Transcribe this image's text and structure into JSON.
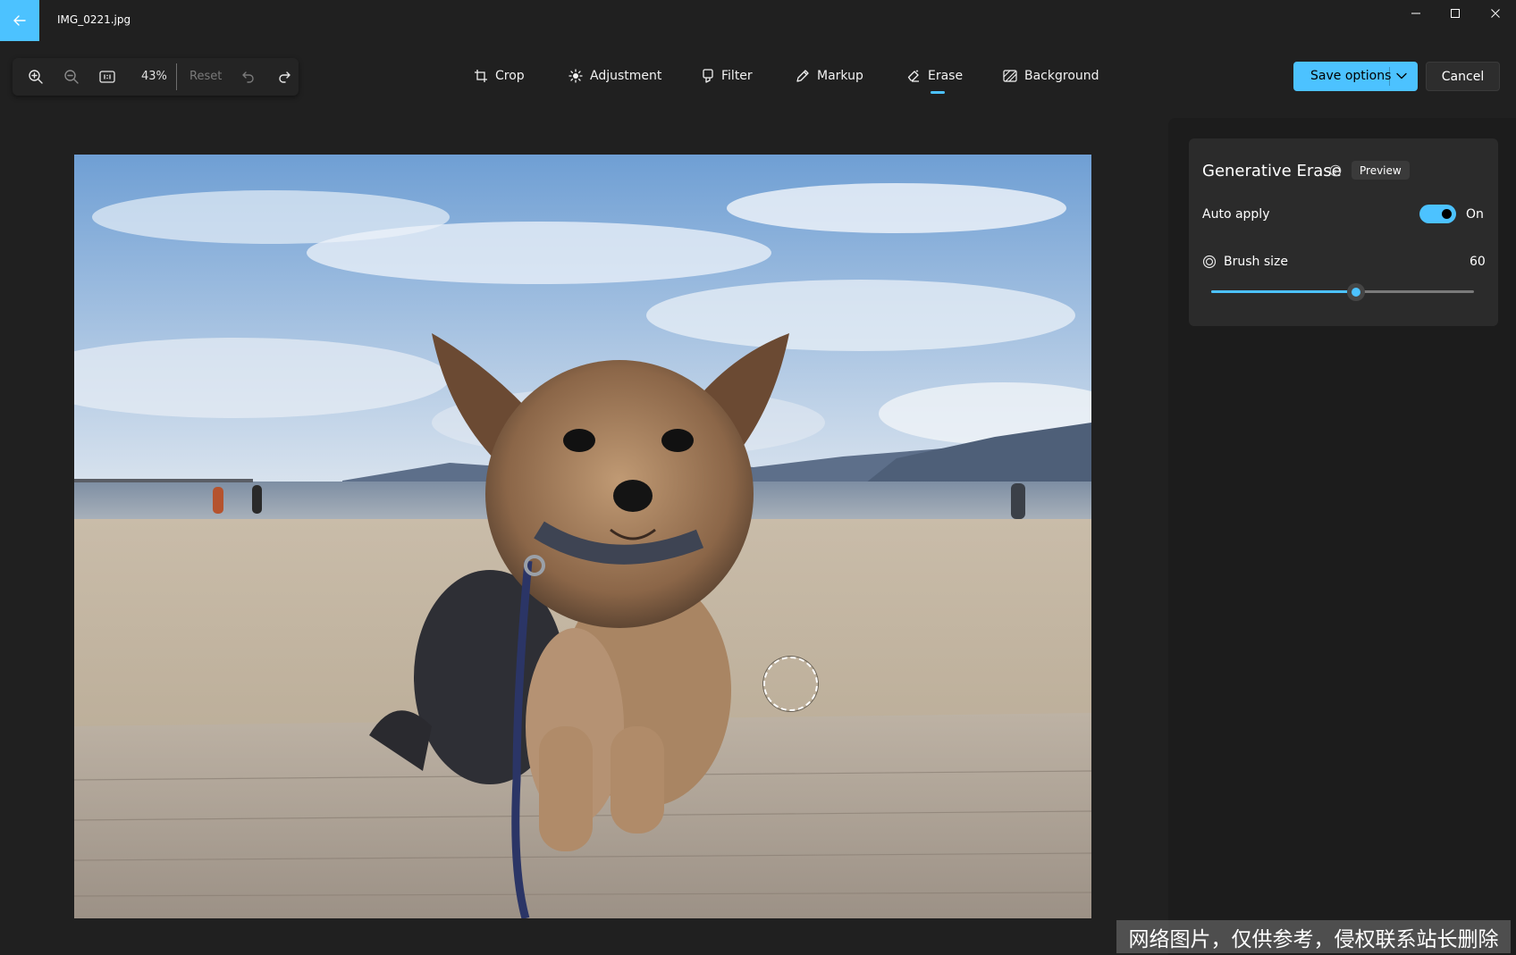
{
  "window": {
    "file_name": "IMG_0221.jpg"
  },
  "toolbar": {
    "zoom_percent": "43%",
    "reset_label": "Reset",
    "tools": [
      {
        "id": "crop",
        "label": "Crop",
        "icon": "crop-icon"
      },
      {
        "id": "adjustment",
        "label": "Adjustment",
        "icon": "brightness-icon"
      },
      {
        "id": "filter",
        "label": "Filter",
        "icon": "filter-icon"
      },
      {
        "id": "markup",
        "label": "Markup",
        "icon": "pen-icon"
      },
      {
        "id": "erase",
        "label": "Erase",
        "icon": "eraser-icon",
        "selected": true
      },
      {
        "id": "background",
        "label": "Background",
        "icon": "background-icon"
      }
    ],
    "save_label": "Save options",
    "cancel_label": "Cancel"
  },
  "erase_panel": {
    "title": "Generative Erase",
    "badge": "Preview",
    "auto_apply": {
      "label": "Auto apply",
      "state_label": "On",
      "enabled": true
    },
    "brush_size": {
      "label": "Brush size",
      "value": "60",
      "fraction": 0.55
    }
  },
  "watermark": "网络图片，仅供参考，侵权联系站长删除",
  "colors": {
    "accent": "#4cc2ff",
    "app_background": "#202020",
    "panel_card": "#2b2b2b"
  }
}
